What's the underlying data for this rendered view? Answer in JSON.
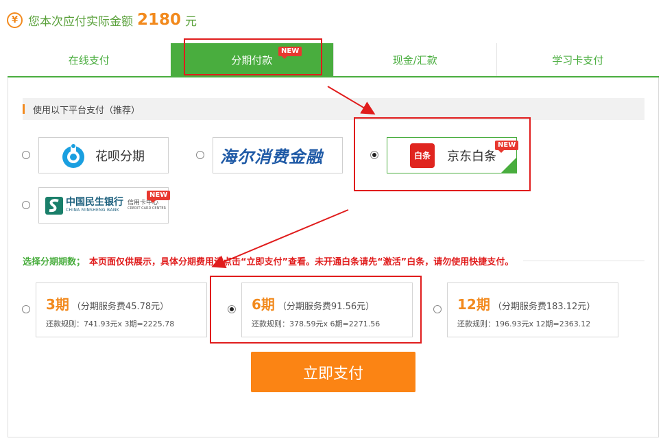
{
  "header": {
    "label": "您本次应付实际金额",
    "amount": "2180",
    "unit": "元",
    "icon": "yen-icon",
    "icon_glyph": "¥"
  },
  "tabs": [
    {
      "label": "在线支付",
      "active": false
    },
    {
      "label": "分期付款",
      "active": true,
      "badge": "NEW"
    },
    {
      "label": "现金/汇款",
      "active": false
    },
    {
      "label": "学习卡支付",
      "active": false
    }
  ],
  "platforms": {
    "title": "使用以下平台支付（推荐）",
    "items": [
      {
        "id": "huabei",
        "label": "花呗分期",
        "selected": false
      },
      {
        "id": "haier",
        "label": "海尔消费金融",
        "logo_text": "海尔消费金融",
        "selected": false
      },
      {
        "id": "jd-baitiao",
        "label": "京东白条",
        "logo_text": "白条",
        "badge": "NEW",
        "selected": true
      },
      {
        "id": "cmbc",
        "label": "中国民生银行",
        "en": "CHINA MINSHENG BANK",
        "sub1": "信用卡中心",
        "sub2": "CREDIT CARD CENTER",
        "badge": "NEW",
        "selected": false
      }
    ]
  },
  "installments": {
    "title": "选择分期期数；",
    "note": "本页面仅供展示，具体分期费用请点击“立即支付”查看。未开通白条请先“激活”白条，请勿使用快捷支付。",
    "options": [
      {
        "period": "3期",
        "fee": "（分期服务费45.78元）",
        "rule": "还款规则：741.93元x 3期=2225.78",
        "selected": false
      },
      {
        "period": "6期",
        "fee": "（分期服务费91.56元）",
        "rule": "还款规则：378.59元x 6期=2271.56",
        "selected": true
      },
      {
        "period": "12期",
        "fee": "（分期服务费183.12元）",
        "rule": "还款规则：196.93元x 12期=2363.12",
        "selected": false
      }
    ]
  },
  "pay_button": {
    "label": "立即支付"
  },
  "colors": {
    "green": "#49ad3e",
    "orange": "#f28a1e",
    "red": "#e01c1c",
    "button": "#fb8414"
  }
}
